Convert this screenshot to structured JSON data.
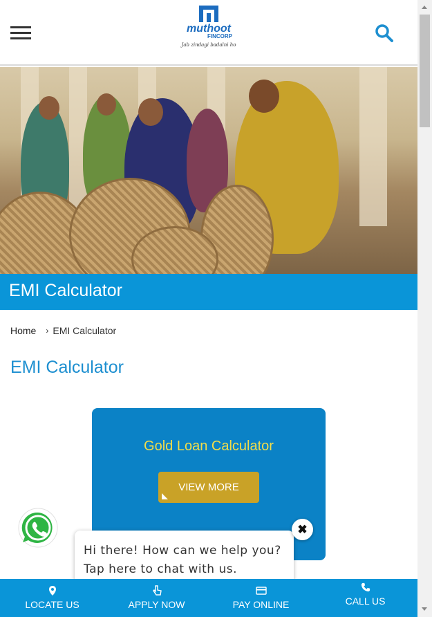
{
  "header": {
    "logo_name": "muthoot",
    "logo_sub": "FINCORP",
    "logo_tagline": "Jab zindagi badalni ho",
    "menu_icon": "hamburger-icon",
    "search_icon": "search-icon"
  },
  "hero": {
    "alt": "Women weaving baskets"
  },
  "title_band": {
    "title": "EMI Calculator"
  },
  "breadcrumb": {
    "home": "Home",
    "current": "EMI Calculator"
  },
  "main": {
    "heading": "EMI Calculator"
  },
  "card": {
    "title": "Gold Loan Calculator",
    "button_label": "VIEW MORE"
  },
  "chat": {
    "message": "Hi there! How can we help you? Tap here to chat with us.",
    "close_icon": "close-icon",
    "whatsapp_icon": "whatsapp-icon"
  },
  "bottom_bar": {
    "items": [
      {
        "label": "LOCATE US",
        "icon": "location-pin-icon"
      },
      {
        "label": "APPLY NOW",
        "icon": "hand-pointer-icon"
      },
      {
        "label": "PAY ONLINE",
        "icon": "credit-card-icon"
      },
      {
        "label": "CALL US",
        "icon": "phone-icon"
      }
    ]
  },
  "colors": {
    "brand_blue": "#0a95d8",
    "card_blue": "#0b82c6",
    "card_title_yellow": "#f2dd4a",
    "button_gold": "#c9a227",
    "heading_blue": "#1d8fd0"
  }
}
